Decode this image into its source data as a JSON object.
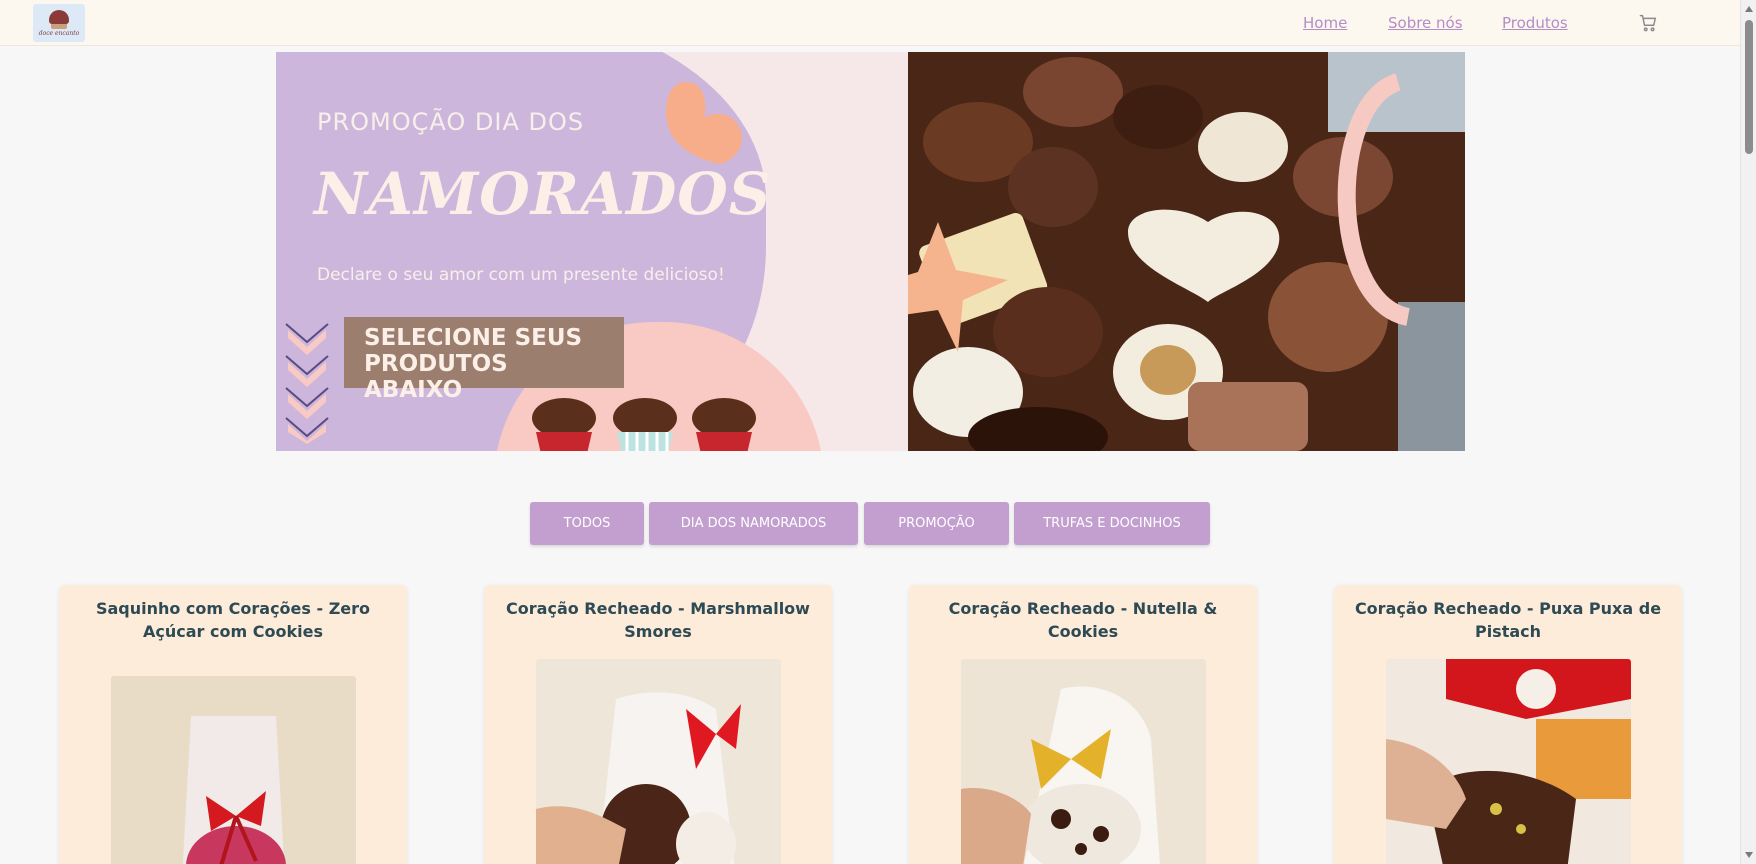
{
  "header": {
    "logo_text": "doce encanto",
    "nav": [
      {
        "label": "Home"
      },
      {
        "label": "Sobre nós"
      },
      {
        "label": "Produtos"
      }
    ],
    "cart_icon": "shopping-cart-icon"
  },
  "banner": {
    "promo_line": "PROMOÇÃO DIA DOS",
    "promo_big": "NAMORADOS",
    "promo_sub": "Declare o seu amor com um presente delicioso!",
    "cta": "SELECIONE SEUS PRODUTOS ABAIXO"
  },
  "filters": [
    {
      "label": "TODOS"
    },
    {
      "label": "DIA DOS NAMORADOS"
    },
    {
      "label": "PROMOÇÃO"
    },
    {
      "label": "TRUFAS E DOCINHOS"
    }
  ],
  "products": [
    {
      "title": "Saquinho com Corações - Zero Açúcar com Cookies"
    },
    {
      "title": "Coração Recheado - Marshmallow Smores"
    },
    {
      "title": "Coração Recheado - Nutella & Cookies"
    },
    {
      "title": "Coração Recheado - Puxa Puxa de Pistach"
    }
  ],
  "colors": {
    "accent_purple": "#c39fd0",
    "nav_link": "#b48cc8",
    "card_bg": "#fdecd9",
    "title_text": "#2e4a54"
  }
}
